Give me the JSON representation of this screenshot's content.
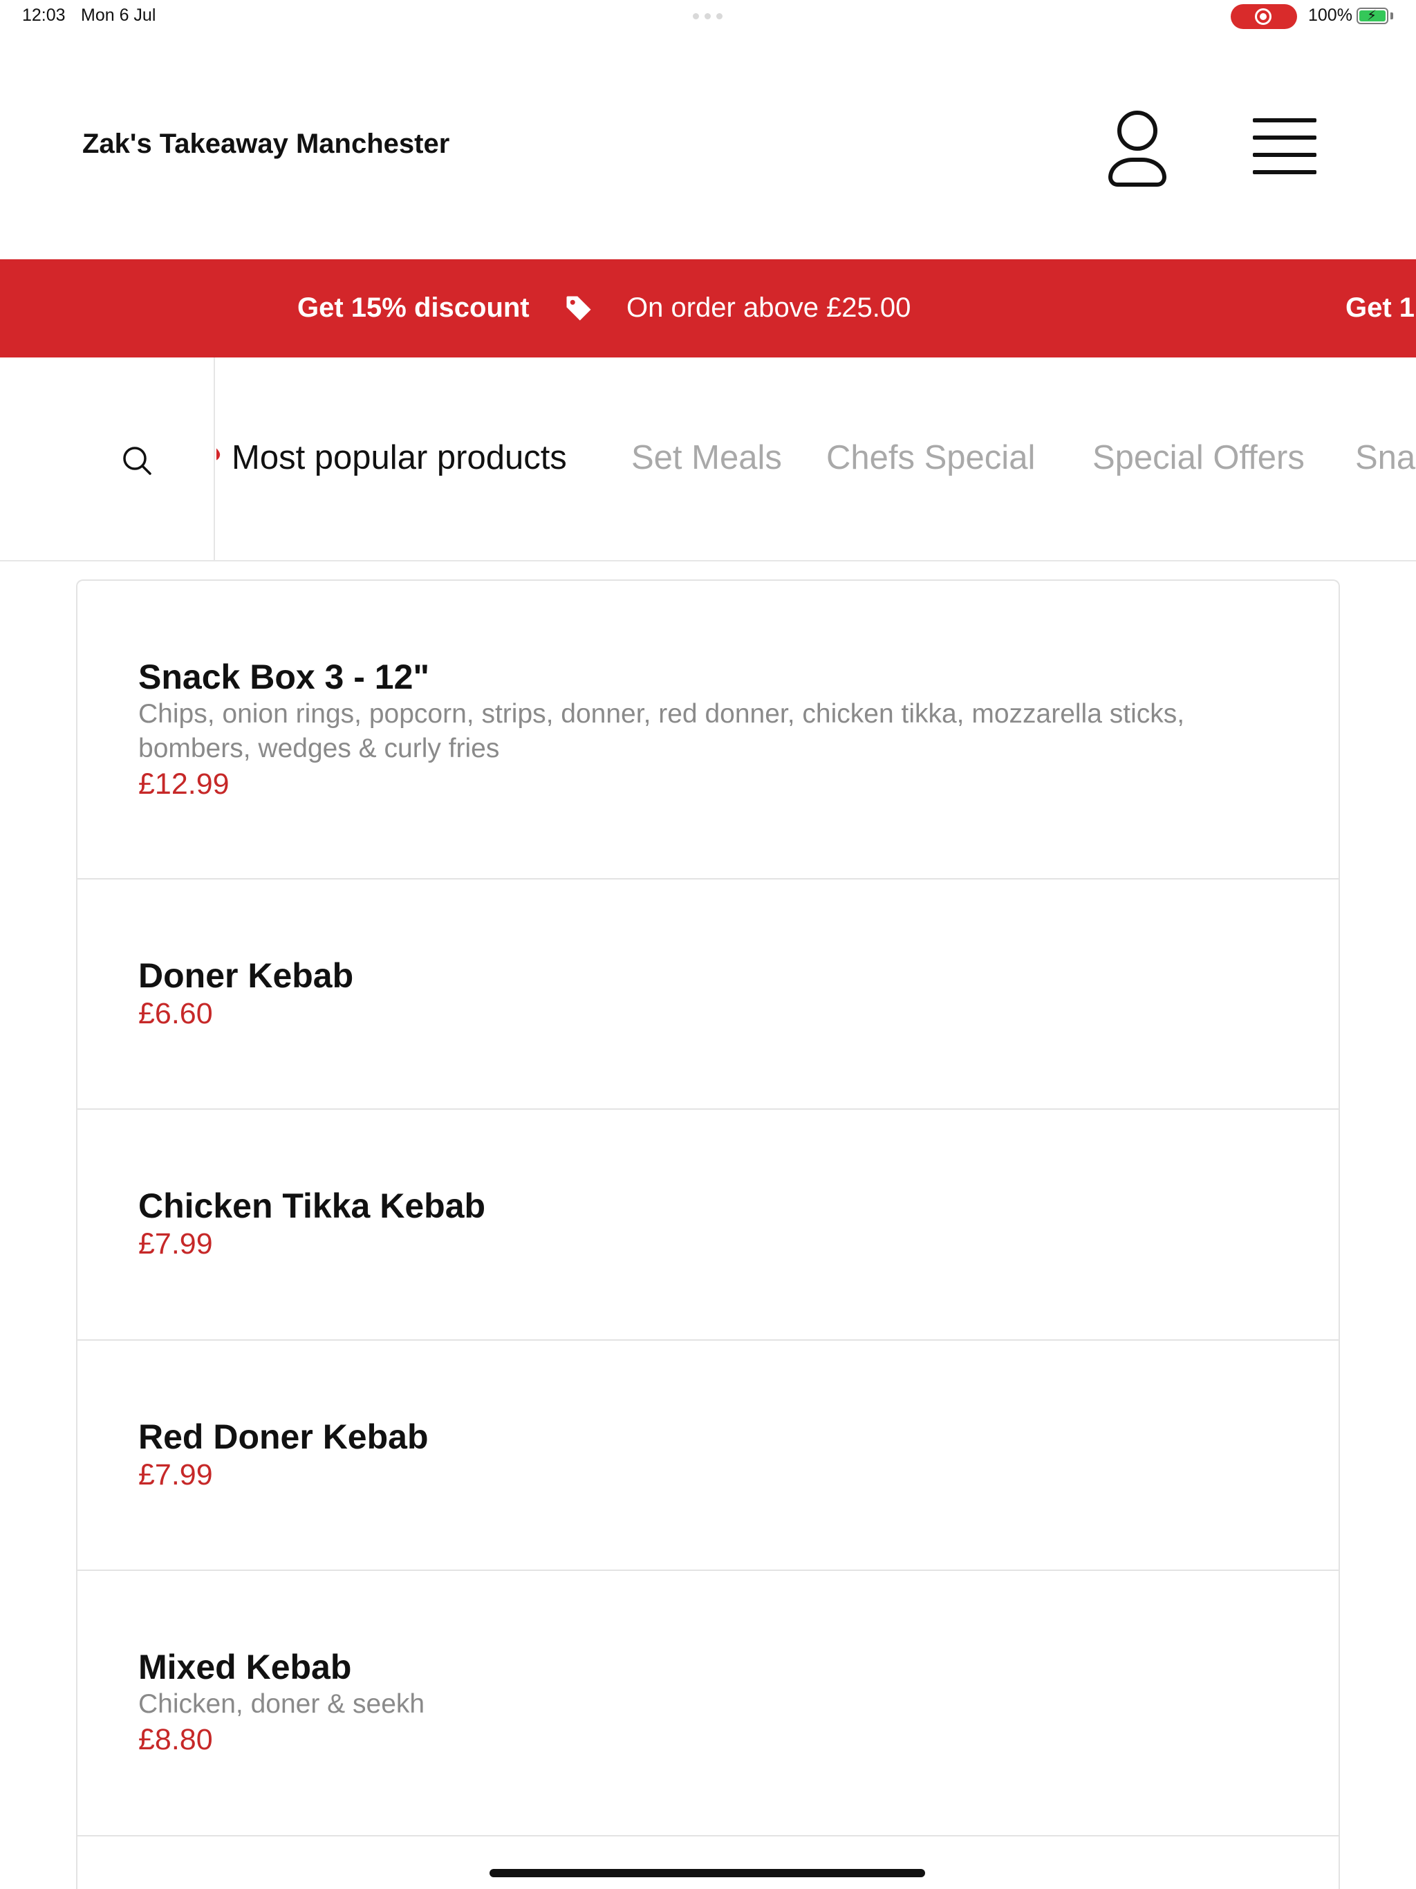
{
  "status_bar": {
    "time": "12:03",
    "date": "Mon 6 Jul",
    "battery": "100%",
    "battery_level": 1.0,
    "recording_indicator": "screen-recording-icon"
  },
  "header": {
    "title": "Zak's Takeaway Manchester",
    "account_icon": "user-icon",
    "menu_icon": "hamburger-menu-icon"
  },
  "promo": {
    "headline": "Get 15% discount",
    "condition": "On order above £25.00",
    "repeat_headline": "Get 1",
    "tag_icon": "price-tag-icon",
    "background_color": "#d3262a"
  },
  "categories": {
    "search_icon": "search-icon",
    "tabs": [
      {
        "label": "Most popular products",
        "active": true
      },
      {
        "label": "Set Meals",
        "active": false
      },
      {
        "label": "Chefs Special",
        "active": false
      },
      {
        "label": "Special Offers",
        "active": false
      },
      {
        "label": "Sna",
        "active": false
      }
    ]
  },
  "products": [
    {
      "name": "Snack Box 3 - 12\"",
      "description": "Chips, onion rings, popcorn, strips, donner, red donner, chicken tikka, mozzarella sticks, bombers, wedges & curly fries",
      "price": "£12.99"
    },
    {
      "name": "Doner Kebab",
      "description": "",
      "price": "£6.60"
    },
    {
      "name": "Chicken Tikka Kebab",
      "description": "",
      "price": "£7.99"
    },
    {
      "name": "Red Doner Kebab",
      "description": "",
      "price": "£7.99"
    },
    {
      "name": "Mixed Kebab",
      "description": "Chicken, doner & seekh",
      "price": "£8.80"
    }
  ],
  "colors": {
    "accent": "#d3262a",
    "price": "#c62828",
    "inactive_tab": "#a9a9a9"
  }
}
